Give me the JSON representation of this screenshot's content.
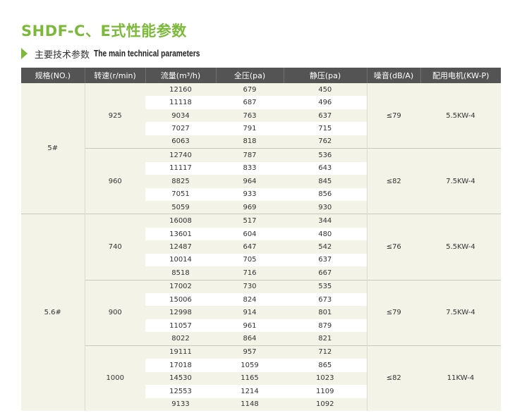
{
  "title": "SHDF-C、E式性能参数",
  "subtitle": {
    "zh": "主要技术参数",
    "en": "The main technical parameters",
    "marker_color": "#7cb93a"
  },
  "table": {
    "headers": [
      "规格(NO.)",
      "转速(r/min)",
      "流量(m³/h)",
      "全压(pa)",
      "静压(pa)",
      "噪音(dB/A)",
      "配用电机(KW-P)"
    ],
    "groups": [
      {
        "model": "5#",
        "speeds": [
          {
            "speed": "925",
            "noise": "≤79",
            "motor": "5.5KW-4",
            "rows": [
              [
                "12160",
                "679",
                "450"
              ],
              [
                "11118",
                "687",
                "496"
              ],
              [
                "9034",
                "763",
                "637"
              ],
              [
                "7027",
                "791",
                "715"
              ],
              [
                "6063",
                "818",
                "762"
              ]
            ]
          },
          {
            "speed": "960",
            "noise": "≤82",
            "motor": "7.5KW-4",
            "rows": [
              [
                "12740",
                "787",
                "536"
              ],
              [
                "11117",
                "833",
                "643"
              ],
              [
                "8825",
                "964",
                "845"
              ],
              [
                "7051",
                "933",
                "856"
              ],
              [
                "5059",
                "969",
                "930"
              ]
            ]
          }
        ]
      },
      {
        "model": "5.6#",
        "speeds": [
          {
            "speed": "740",
            "noise": "≤76",
            "motor": "5.5KW-4",
            "rows": [
              [
                "16008",
                "517",
                "344"
              ],
              [
                "13601",
                "604",
                "480"
              ],
              [
                "12487",
                "647",
                "542"
              ],
              [
                "10014",
                "705",
                "637"
              ],
              [
                "8518",
                "716",
                "667"
              ]
            ]
          },
          {
            "speed": "900",
            "noise": "≤79",
            "motor": "7.5KW-4",
            "rows": [
              [
                "17002",
                "730",
                "535"
              ],
              [
                "15006",
                "824",
                "673"
              ],
              [
                "12998",
                "914",
                "801"
              ],
              [
                "11057",
                "961",
                "879"
              ],
              [
                "8022",
                "864",
                "821"
              ]
            ]
          },
          {
            "speed": "1000",
            "noise": "≤82",
            "motor": "11KW-4",
            "rows": [
              [
                "19111",
                "957",
                "712"
              ],
              [
                "17018",
                "1059",
                "865"
              ],
              [
                "14530",
                "1165",
                "1023"
              ],
              [
                "12553",
                "1214",
                "1109"
              ],
              [
                "9133",
                "1148",
                "1092"
              ]
            ]
          }
        ]
      }
    ]
  },
  "colors": {
    "title": "#7cb93a",
    "header_bg": "#555454",
    "stripe": "#f3f3e8"
  }
}
